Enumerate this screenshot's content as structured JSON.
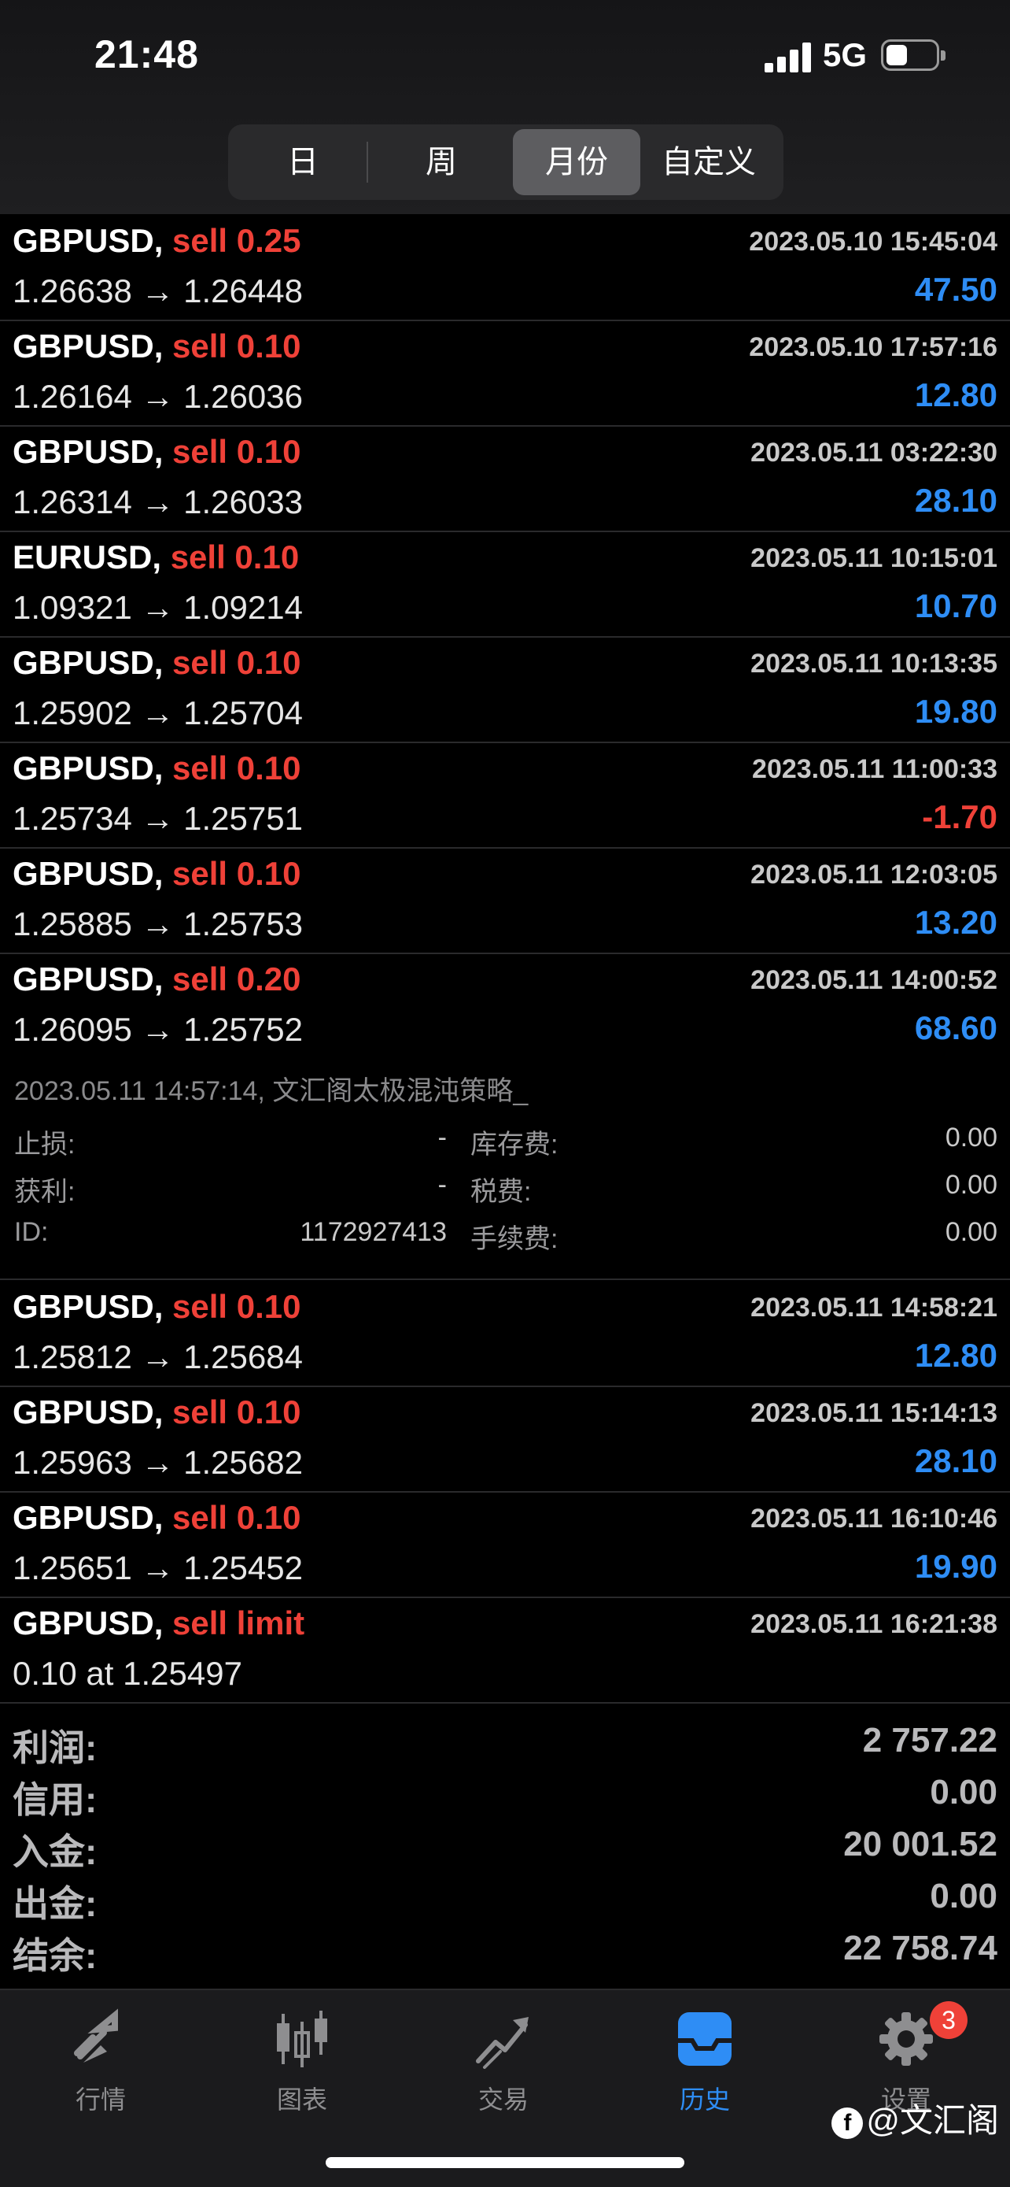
{
  "status": {
    "time": "21:48",
    "network": "5G"
  },
  "period_tabs": [
    {
      "label": "日"
    },
    {
      "label": "周"
    },
    {
      "label": "月份"
    },
    {
      "label": "自定义"
    }
  ],
  "trades": [
    {
      "symbol": "GBPUSD,",
      "side": "sell 0.25",
      "time": "2023.05.10 15:45:04",
      "prices": "1.26638 → 1.26448",
      "profit": "47.50",
      "sign": "pos"
    },
    {
      "symbol": "GBPUSD,",
      "side": "sell 0.10",
      "time": "2023.05.10 17:57:16",
      "prices": "1.26164 → 1.26036",
      "profit": "12.80",
      "sign": "pos"
    },
    {
      "symbol": "GBPUSD,",
      "side": "sell 0.10",
      "time": "2023.05.11 03:22:30",
      "prices": "1.26314 → 1.26033",
      "profit": "28.10",
      "sign": "pos"
    },
    {
      "symbol": "EURUSD,",
      "side": "sell 0.10",
      "time": "2023.05.11 10:15:01",
      "prices": "1.09321 → 1.09214",
      "profit": "10.70",
      "sign": "pos"
    },
    {
      "symbol": "GBPUSD,",
      "side": "sell 0.10",
      "time": "2023.05.11 10:13:35",
      "prices": "1.25902 → 1.25704",
      "profit": "19.80",
      "sign": "pos"
    },
    {
      "symbol": "GBPUSD,",
      "side": "sell 0.10",
      "time": "2023.05.11 11:00:33",
      "prices": "1.25734 → 1.25751",
      "profit": "-1.70",
      "sign": "neg"
    },
    {
      "symbol": "GBPUSD,",
      "side": "sell 0.10",
      "time": "2023.05.11 12:03:05",
      "prices": "1.25885 → 1.25753",
      "profit": "13.20",
      "sign": "pos"
    },
    {
      "symbol": "GBPUSD,",
      "side": "sell 0.20",
      "time": "2023.05.11 14:00:52",
      "prices": "1.26095 → 1.25752",
      "profit": "68.60",
      "sign": "pos"
    },
    {
      "symbol": "GBPUSD,",
      "side": "sell 0.10",
      "time": "2023.05.11 14:58:21",
      "prices": "1.25812 → 1.25684",
      "profit": "12.80",
      "sign": "pos"
    },
    {
      "symbol": "GBPUSD,",
      "side": "sell 0.10",
      "time": "2023.05.11 15:14:13",
      "prices": "1.25963 → 1.25682",
      "profit": "28.10",
      "sign": "pos"
    },
    {
      "symbol": "GBPUSD,",
      "side": "sell 0.10",
      "time": "2023.05.11 16:10:46",
      "prices": "1.25651 → 1.25452",
      "profit": "19.90",
      "sign": "pos"
    },
    {
      "symbol": "GBPUSD,",
      "side": "sell limit",
      "time": "2023.05.11 16:21:38",
      "prices": "0.10 at 1.25497",
      "profit": "",
      "sign": "pos"
    }
  ],
  "detail": {
    "comment": "2023.05.11 14:57:14, 文汇阁太极混沌策略_",
    "sl_label": "止损:",
    "sl_value": "-",
    "tp_label": "获利:",
    "tp_value": "-",
    "id_label": "ID:",
    "id_value": "1172927413",
    "swap_label": "库存费:",
    "swap_value": "0.00",
    "tax_label": "税费:",
    "tax_value": "0.00",
    "fee_label": "手续费:",
    "fee_value": "0.00"
  },
  "summary": [
    {
      "label": "利润:",
      "value": "2 757.22"
    },
    {
      "label": "信用:",
      "value": "0.00"
    },
    {
      "label": "入金:",
      "value": "20 001.52"
    },
    {
      "label": "出金:",
      "value": "0.00"
    },
    {
      "label": "结余:",
      "value": "22 758.74"
    }
  ],
  "bottom_tabs": [
    {
      "label": "行情",
      "icon": "quotes-arrows-icon"
    },
    {
      "label": "图表",
      "icon": "candlestick-chart-icon"
    },
    {
      "label": "交易",
      "icon": "trade-trend-icon"
    },
    {
      "label": "历史",
      "icon": "history-inbox-icon"
    },
    {
      "label": "设置",
      "icon": "gear-icon",
      "badge": "3"
    }
  ],
  "watermark": "@文汇阁",
  "colors": {
    "sell": "#ef4138",
    "profit_positive": "#2e8df5",
    "profit_negative": "#ef4138",
    "active_tab": "#2e8df5"
  }
}
